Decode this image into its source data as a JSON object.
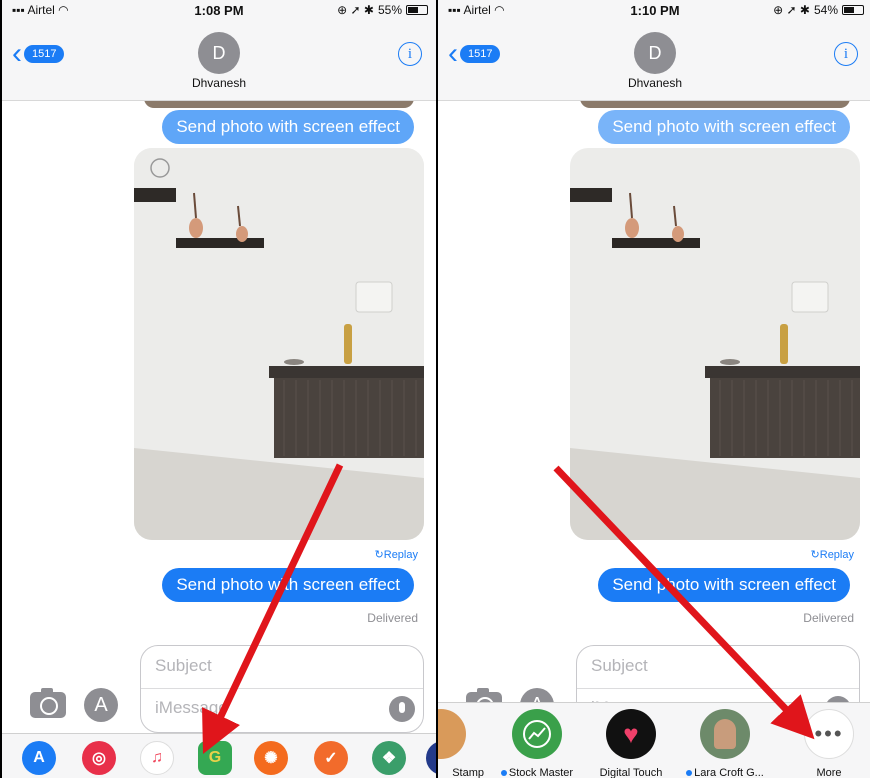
{
  "left": {
    "status": {
      "carrier": "Airtel",
      "time": "1:08 PM",
      "battery": "55%",
      "battery_level": 0.55
    },
    "header": {
      "back_badge": "1517",
      "avatar_initial": "D",
      "contact_name": "Dhvanesh",
      "info": "i"
    },
    "messages": {
      "top_bubble": "Send photo with screen effect",
      "replay": "↻Replay",
      "bottom_bubble": "Send photo with screen effect",
      "delivered": "Delivered"
    },
    "compose": {
      "subject_placeholder": "Subject",
      "message_placeholder": "iMessage"
    }
  },
  "right": {
    "status": {
      "carrier": "Airtel",
      "time": "1:10 PM",
      "battery": "54%",
      "battery_level": 0.54
    },
    "header": {
      "back_badge": "1517",
      "avatar_initial": "D",
      "contact_name": "Dhvanesh",
      "info": "i"
    },
    "messages": {
      "top_bubble": "Send photo with screen effect",
      "replay": "↻Replay",
      "bottom_bubble": "Send photo with screen effect",
      "delivered": "Delivered"
    },
    "compose": {
      "subject_placeholder": "Subject",
      "message_placeholder": "iMessage"
    },
    "apps": [
      {
        "label": "Stamp"
      },
      {
        "label": "Stock Master",
        "dot": true
      },
      {
        "label": "Digital Touch"
      },
      {
        "label": "Lara Croft G...",
        "dot": true
      },
      {
        "label": "More"
      }
    ]
  },
  "drawer_left_icons": [
    "app-store-icon",
    "search-images-icon",
    "music-icon",
    "maps-icon",
    "sticker-icon",
    "checkmark-icon",
    "game-icon",
    "news-icon"
  ],
  "colors": {
    "ios_blue": "#1b7cf5",
    "arrow_red": "#e0151b"
  }
}
